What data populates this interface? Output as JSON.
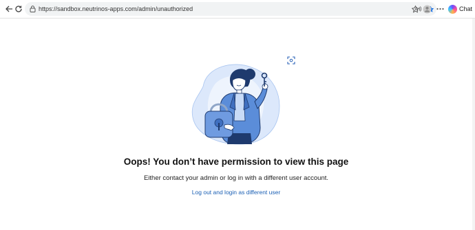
{
  "browser": {
    "url": "https://sandbox.neutrinos-apps.com/admin/unauthorized",
    "chat_label": "Chat",
    "icons": {
      "back": "arrow-left-icon",
      "refresh": "refresh-icon",
      "lock": "lock-icon",
      "read_aloud": "read-aloud-icon",
      "favorite": "star-icon",
      "collections": "collections-icon",
      "profile": "profile-icon",
      "more": "more-icon"
    },
    "accent": "#1a73e8"
  },
  "main": {
    "heading": "Oops! You don’t have permission to view this page",
    "message": "Either contact your admin or log in with a different user account.",
    "link_label": "Log out and login as different user",
    "colors": {
      "link": "#1a5fb4",
      "illustration_primary": "#5b8dd9",
      "illustration_light": "#dce8fb",
      "illustration_dark": "#1e3a6e"
    }
  }
}
